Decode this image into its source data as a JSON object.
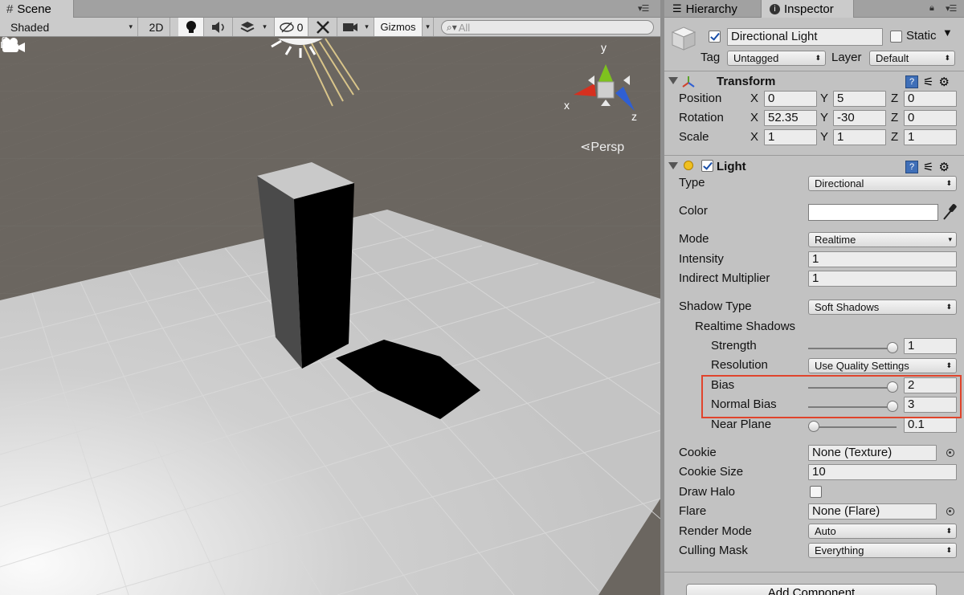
{
  "scene": {
    "tab_label": "Scene",
    "tab_icon": "grid-icon",
    "shading_mode": "Shaded",
    "mode_2d": "2D",
    "hidden_count": "0",
    "gizmos_label": "Gizmos",
    "search_placeholder": "All",
    "projection_label": "Persp",
    "axis_x": "x",
    "axis_y": "y",
    "axis_z": "z",
    "colors": {
      "x_axis": "#d6301f",
      "y_axis": "#7ec21e",
      "z_axis": "#2f5fd3",
      "sky": "#6b6660",
      "floor": "#c8c8c8"
    }
  },
  "tabs": {
    "hierarchy": "Hierarchy",
    "inspector": "Inspector"
  },
  "object": {
    "enabled": true,
    "name": "Directional Light",
    "static_label": "Static",
    "static_checked": false,
    "tag_label": "Tag",
    "tag_value": "Untagged",
    "layer_label": "Layer",
    "layer_value": "Default"
  },
  "transform": {
    "title": "Transform",
    "position_label": "Position",
    "rotation_label": "Rotation",
    "scale_label": "Scale",
    "position": {
      "x": "0",
      "y": "5",
      "z": "0"
    },
    "rotation": {
      "x": "52.35",
      "y": "-30",
      "z": "0"
    },
    "scale": {
      "x": "1",
      "y": "1",
      "z": "1"
    },
    "x": "X",
    "y": "Y",
    "z": "Z"
  },
  "light": {
    "title": "Light",
    "enabled": true,
    "type_label": "Type",
    "type_value": "Directional",
    "color_label": "Color",
    "color_value": "#ffffff",
    "mode_label": "Mode",
    "mode_value": "Realtime",
    "intensity_label": "Intensity",
    "intensity_value": "1",
    "indirect_label": "Indirect Multiplier",
    "indirect_value": "1",
    "shadow_type_label": "Shadow Type",
    "shadow_type_value": "Soft Shadows",
    "realtime_shadows_label": "Realtime Shadows",
    "strength_label": "Strength",
    "strength_value": "1",
    "strength_fraction": 1.0,
    "resolution_label": "Resolution",
    "resolution_value": "Use Quality Settings",
    "bias_label": "Bias",
    "bias_value": "2",
    "bias_fraction": 1.0,
    "normal_bias_label": "Normal Bias",
    "normal_bias_value": "3",
    "normal_bias_fraction": 1.0,
    "near_plane_label": "Near Plane",
    "near_plane_value": "0.1",
    "near_plane_fraction": 0.0,
    "cookie_label": "Cookie",
    "cookie_value": "None (Texture)",
    "cookie_size_label": "Cookie Size",
    "cookie_size_value": "10",
    "draw_halo_label": "Draw Halo",
    "draw_halo_checked": false,
    "flare_label": "Flare",
    "flare_value": "None (Flare)",
    "render_mode_label": "Render Mode",
    "render_mode_value": "Auto",
    "culling_mask_label": "Culling Mask",
    "culling_mask_value": "Everything"
  },
  "add_component_label": "Add Component"
}
